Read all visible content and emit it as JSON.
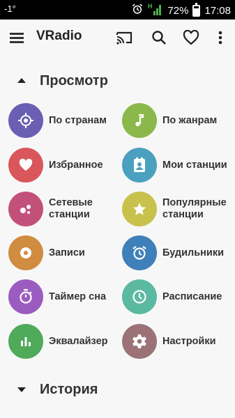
{
  "status_bar": {
    "left_text": "-1°",
    "battery": "72%",
    "time": "17:08",
    "signal_type": "H",
    "battery_level": 0.72
  },
  "toolbar": {
    "title": "VRadio",
    "icons": [
      "menu-icon",
      "cast-icon",
      "search-icon",
      "heart-outline-icon",
      "more-vert-icon"
    ]
  },
  "sections": {
    "browse": {
      "title": "Просмотр",
      "expanded": true
    },
    "history": {
      "title": "История",
      "expanded": true
    }
  },
  "items": [
    {
      "label": "По странам",
      "icon": "target-icon",
      "color": "#6a5fb3"
    },
    {
      "label": "По жанрам",
      "icon": "music-note-icon",
      "color": "#8bb84a"
    },
    {
      "label": "Избранное",
      "icon": "heart-icon",
      "color": "#d9565a"
    },
    {
      "label": "Мои станции",
      "icon": "contact-icon",
      "color": "#4ba0bf"
    },
    {
      "label": "Сетевые станции",
      "icon": "network-icon",
      "color": "#c2517a"
    },
    {
      "label": "Популярные станции",
      "icon": "star-icon",
      "color": "#c8c24d"
    },
    {
      "label": "Записи",
      "icon": "record-icon",
      "color": "#d08c3f"
    },
    {
      "label": "Будильники",
      "icon": "alarm-icon",
      "color": "#3f7fba"
    },
    {
      "label": "Таймер сна",
      "icon": "timer-icon",
      "color": "#9b5cc0"
    },
    {
      "label": "Расписание",
      "icon": "clock-icon",
      "color": "#5cb9a1"
    },
    {
      "label": "Эквалайзер",
      "icon": "equalizer-icon",
      "color": "#4faa5a"
    },
    {
      "label": "Настройки",
      "icon": "settings-icon",
      "color": "#9b7377"
    }
  ]
}
